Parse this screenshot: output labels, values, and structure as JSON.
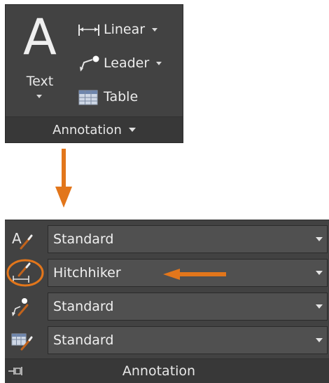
{
  "top_panel": {
    "text_tool": {
      "glyph": "A",
      "label": "Text"
    },
    "tools": [
      {
        "label": "Linear",
        "icon": "linear-dimension-icon"
      },
      {
        "label": "Leader",
        "icon": "leader-icon"
      },
      {
        "label": "Table",
        "icon": "table-icon"
      }
    ],
    "title": "Annotation"
  },
  "bottom_panel": {
    "styles": [
      {
        "icon": "text-style-icon",
        "value": "Standard"
      },
      {
        "icon": "dimension-style-icon",
        "value": "Hitchhiker"
      },
      {
        "icon": "multileader-style-icon",
        "value": "Standard"
      },
      {
        "icon": "table-style-icon",
        "value": "Standard"
      }
    ],
    "title": "Annotation"
  },
  "colors": {
    "panel_bg": "#424242",
    "accent_orange": "#e2761b"
  }
}
